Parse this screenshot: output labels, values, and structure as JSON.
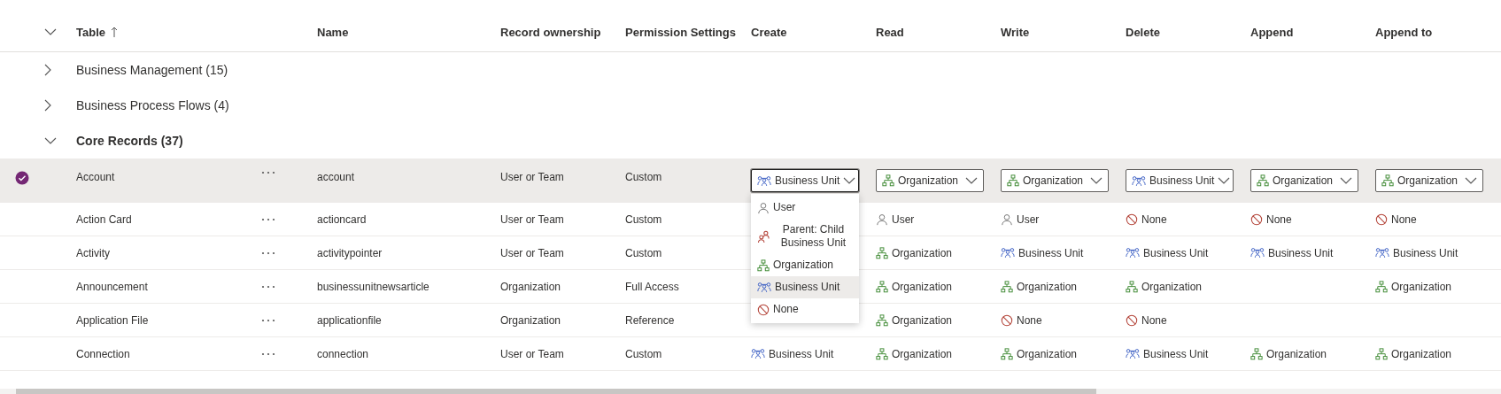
{
  "columns": [
    {
      "label": "Table",
      "sorted": true
    },
    {
      "label": "Name",
      "sorted": false
    },
    {
      "label": "Record ownership",
      "sorted": false
    },
    {
      "label": "Permission Settings",
      "sorted": false
    },
    {
      "label": "Create",
      "sorted": false
    },
    {
      "label": "Read",
      "sorted": false
    },
    {
      "label": "Write",
      "sorted": false
    },
    {
      "label": "Delete",
      "sorted": false
    },
    {
      "label": "Append",
      "sorted": false
    },
    {
      "label": "Append to",
      "sorted": false
    }
  ],
  "groups": [
    {
      "label": "Business Management (15)",
      "expanded": false
    },
    {
      "label": "Business Process Flows (4)",
      "expanded": false
    },
    {
      "label": "Core Records (37)",
      "expanded": true,
      "rows": [
        {
          "table": "Account",
          "name": "account",
          "ownership": "User or Team",
          "permission": "Custom",
          "selected": true,
          "privileges": {
            "create": {
              "kind": "business-unit",
              "label": "Business Unit",
              "open": true,
              "options": [
                {
                  "kind": "user",
                  "label": "User",
                  "selected": false
                },
                {
                  "kind": "parent-child",
                  "label": "Parent: Child Business Unit",
                  "selected": false
                },
                {
                  "kind": "organization",
                  "label": "Organization",
                  "selected": false
                },
                {
                  "kind": "business-unit",
                  "label": "Business Unit",
                  "selected": true
                },
                {
                  "kind": "none",
                  "label": "None",
                  "selected": false
                }
              ]
            },
            "read": {
              "kind": "organization",
              "label": "Organization",
              "open": false
            },
            "write": {
              "kind": "organization",
              "label": "Organization",
              "open": false
            },
            "delete": {
              "kind": "business-unit",
              "label": "Business Unit",
              "open": false
            },
            "append": {
              "kind": "organization",
              "label": "Organization",
              "open": false
            },
            "append_to": {
              "kind": "organization",
              "label": "Organization",
              "open": false
            }
          }
        },
        {
          "table": "Action Card",
          "name": "actioncard",
          "ownership": "User or Team",
          "permission": "Custom",
          "selected": false,
          "privileges": {
            "read": {
              "kind": "user",
              "label": "User"
            },
            "write": {
              "kind": "user",
              "label": "User"
            },
            "delete": {
              "kind": "none",
              "label": "None"
            },
            "append": {
              "kind": "none",
              "label": "None"
            },
            "append_to": {
              "kind": "none",
              "label": "None"
            }
          }
        },
        {
          "table": "Activity",
          "name": "activitypointer",
          "ownership": "User or Team",
          "permission": "Custom",
          "selected": false,
          "privileges": {
            "read": {
              "kind": "organization",
              "label": "Organization"
            },
            "write": {
              "kind": "business-unit",
              "label": "Business Unit"
            },
            "delete": {
              "kind": "business-unit",
              "label": "Business Unit"
            },
            "append": {
              "kind": "business-unit",
              "label": "Business Unit"
            },
            "append_to": {
              "kind": "business-unit",
              "label": "Business Unit"
            }
          }
        },
        {
          "table": "Announcement",
          "name": "businessunitnewsarticle",
          "ownership": "Organization",
          "permission": "Full Access",
          "selected": false,
          "privileges": {
            "read": {
              "kind": "organization",
              "label": "Organization"
            },
            "write": {
              "kind": "organization",
              "label": "Organization"
            },
            "delete": {
              "kind": "organization",
              "label": "Organization"
            },
            "append_to": {
              "kind": "organization",
              "label": "Organization"
            }
          }
        },
        {
          "table": "Application File",
          "name": "applicationfile",
          "ownership": "Organization",
          "permission": "Reference",
          "selected": false,
          "privileges": {
            "read": {
              "kind": "organization",
              "label": "Organization"
            },
            "write": {
              "kind": "none",
              "label": "None"
            },
            "delete": {
              "kind": "none",
              "label": "None"
            }
          }
        },
        {
          "table": "Connection",
          "name": "connection",
          "ownership": "User or Team",
          "permission": "Custom",
          "selected": false,
          "privileges": {
            "create": {
              "kind": "business-unit",
              "label": "Business Unit"
            },
            "read": {
              "kind": "organization",
              "label": "Organization"
            },
            "write": {
              "kind": "organization",
              "label": "Organization"
            },
            "delete": {
              "kind": "business-unit",
              "label": "Business Unit"
            },
            "append": {
              "kind": "organization",
              "label": "Organization"
            },
            "append_to": {
              "kind": "organization",
              "label": "Organization"
            }
          }
        }
      ]
    }
  ]
}
